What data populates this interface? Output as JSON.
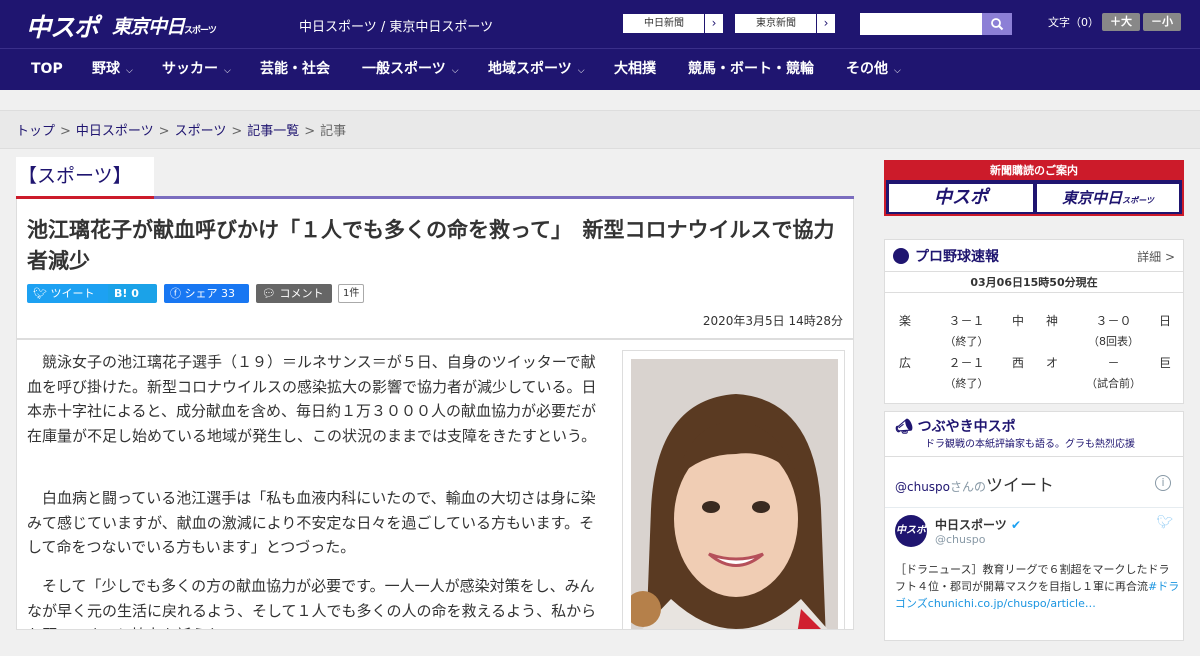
{
  "header": {
    "logo_main": "中スポ",
    "logo_tokyo": "東京中日",
    "logo_tokyo_sub": "スポーツ",
    "site_names": "中日スポーツ / 東京中日スポーツ",
    "partner_links": [
      {
        "label": "中日新聞",
        "arrow": "›"
      },
      {
        "label": "東京新聞",
        "arrow": "›"
      }
    ],
    "search": {
      "placeholder": "",
      "icon": "search-icon"
    },
    "font_size": {
      "label": "文字（0）",
      "bigger": "＋大",
      "smaller": "－小"
    }
  },
  "nav": {
    "items": [
      {
        "label": "TOP",
        "has_dropdown": false
      },
      {
        "label": "野球",
        "has_dropdown": true
      },
      {
        "label": "サッカー",
        "has_dropdown": true
      },
      {
        "label": "芸能・社会",
        "has_dropdown": false
      },
      {
        "label": "一般スポーツ",
        "has_dropdown": true
      },
      {
        "label": "地域スポーツ",
        "has_dropdown": true
      },
      {
        "label": "大相撲",
        "has_dropdown": false
      },
      {
        "label": "競馬・ボート・競輪",
        "has_dropdown": false
      },
      {
        "label": "その他",
        "has_dropdown": true
      }
    ],
    "dropdown_glyph": "⌵"
  },
  "breadcrumb": {
    "items": [
      "トップ",
      "中日スポーツ",
      "スポーツ",
      "記事一覧",
      "記事"
    ],
    "separator": ">"
  },
  "article": {
    "category": "【スポーツ】",
    "headline": "池江璃花子が献血呼びかけ「１人でも多くの命を救って」　新型コロナウイルスで協力者減少",
    "share": {
      "tweet": "ツイート",
      "hatena": "B!",
      "hatena_count": "0",
      "facebook": "シェア",
      "facebook_count": "33",
      "comment": "コメント",
      "comment_count": "1件"
    },
    "date": "2020年3月5日 14時28分",
    "paragraphs": [
      "競泳女子の池江璃花子選手（１９）＝ルネサンス＝が５日、自身のツイッターで献血を呼び掛けた。新型コロナウイルスの感染拡大の影響で協力者が減少している。日本赤十字社によると、成分献血を含め、毎日約１万３０００人の献血協力が必要だが在庫量が不足し始めている地域が発生し、この状況のままでは支障をきたすという。",
      "白血病と闘っている池江選手は「私も血液内科にいたので、輸血の大切さは身に染みて感じていますが、献血の激減により不安定な日々を過ごしている方もいます。そして命をつないでいる方もいます」とつづった。",
      "そして「少しでも多くの方の献血協力が必要です。一人一人が感染対策をし、みんなが早く元の生活に戻れるよう、そして１人でも多くの人の命を救えるよう、私からお願いです」と協力を訴えた。"
    ]
  },
  "sidebar": {
    "ad": {
      "heading": "新聞購読のご案内",
      "logo_main": "中スポ",
      "logo_tokyo": "東京中日",
      "logo_tokyo_sub": "スポーツ"
    },
    "baseball": {
      "title": "プロ野球速報",
      "more": "詳細 >",
      "updated": "03月06日15時50分現在",
      "games": [
        {
          "home": "楽",
          "score": "３－１",
          "away": "中",
          "status": "（終了）"
        },
        {
          "home": "神",
          "score": "３－０",
          "away": "日",
          "status": "（8回表）"
        },
        {
          "home": "広",
          "score": "２－１",
          "away": "西",
          "status": "（終了）"
        },
        {
          "home": "オ",
          "score": "－",
          "away": "巨",
          "status": "（試合前）"
        }
      ]
    },
    "tweets": {
      "title": "つぶやき中スポ",
      "subtitle": "ドラ観戦の本紙評論家も語る。グラも熱烈応援",
      "by_handle": "@chuspo",
      "by_suffix": "さんの",
      "by_label": "ツイート",
      "info": "i",
      "account_name": "中日スポーツ",
      "account_handle": "@chuspo",
      "avatar_text": "中スポ",
      "tweet_text": "［ドラニュース］教育リーグで６割超をマークしたドラフト４位・郡司が開幕マスクを目指し１軍に再合流",
      "tweet_link": "#ドラゴンズchunichi.co.jp/chuspo/article…"
    }
  },
  "colors": {
    "brand_navy": "#1f1570",
    "accent_red": "#cc1b2a",
    "twitter": "#1da1f2",
    "facebook": "#1877f2"
  }
}
